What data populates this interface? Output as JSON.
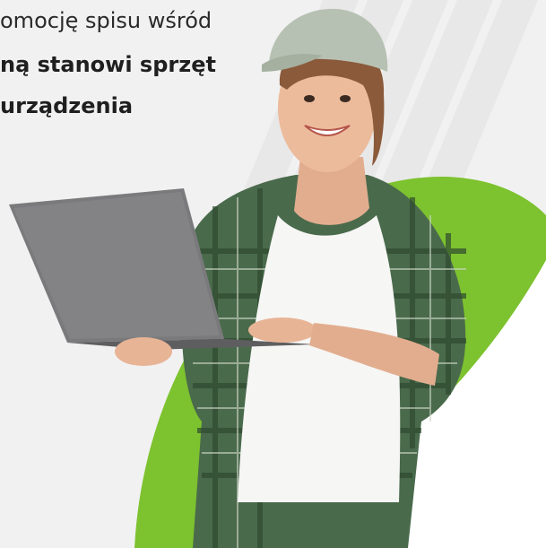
{
  "text": {
    "line1": "omocję spisu wśród",
    "line2": "ną stanowi sprzęt",
    "line3": "urządzenia"
  },
  "colors": {
    "background": "#f1f1f1",
    "accent_green": "#7dc22f",
    "diagonal_stripes": "#e8e8e8",
    "white_shape": "#ffffff",
    "text": "#1f1f1f"
  },
  "photo": {
    "subject": "woman in cap and plaid shirt holding a laptop"
  }
}
